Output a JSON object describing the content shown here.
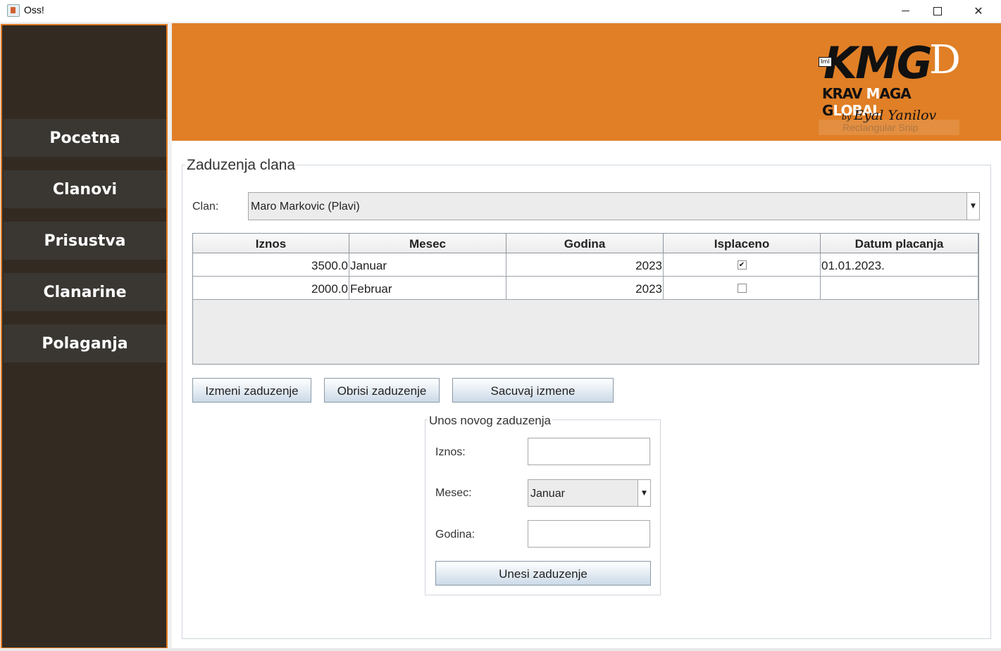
{
  "window": {
    "title": "Oss!"
  },
  "sidebar": {
    "items": [
      {
        "label": "Pocetna"
      },
      {
        "label": "Clanovi"
      },
      {
        "label": "Prisustva"
      },
      {
        "label": "Clanarine"
      },
      {
        "label": "Polaganja"
      }
    ]
  },
  "logo": {
    "main": "KMG",
    "subtitle_dark_1": "KRAV ",
    "subtitle_white_1": "M",
    "subtitle_dark_2": "AGA G",
    "subtitle_white_2": "LOBAL",
    "by": "by",
    "author": "Eyal Yanilov",
    "chip": "Iml",
    "faint_overlay": "Rectangular Snip"
  },
  "panel": {
    "title": "Zaduzenja clana",
    "member_label": "Clan:",
    "member_selected": "Maro Markovic (Plavi)"
  },
  "table": {
    "columns": [
      "Iznos",
      "Mesec",
      "Godina",
      "Isplaceno",
      "Datum placanja"
    ],
    "rows": [
      {
        "iznos": "3500.0",
        "mesec": "Januar",
        "godina": "2023",
        "isplaceno": true,
        "isplaceno_mark": "✔",
        "datum": "01.01.2023."
      },
      {
        "iznos": "2000.0",
        "mesec": "Februar",
        "godina": "2023",
        "isplaceno": false,
        "isplaceno_mark": "",
        "datum": ""
      }
    ]
  },
  "buttons": {
    "edit": "Izmeni zaduzenje",
    "delete": "Obrisi zaduzenje",
    "save": "Sacuvaj izmene"
  },
  "new_entry": {
    "title": "Unos novog zaduzenja",
    "amount_label": "Iznos:",
    "amount_value": "",
    "month_label": "Mesec:",
    "month_selected": "Januar",
    "year_label": "Godina:",
    "year_value": "",
    "submit": "Unesi zaduzenje"
  },
  "colors": {
    "accent": "#e07f26",
    "sidebar_bg": "#332a22",
    "nav_item_bg": "#3a3733"
  }
}
